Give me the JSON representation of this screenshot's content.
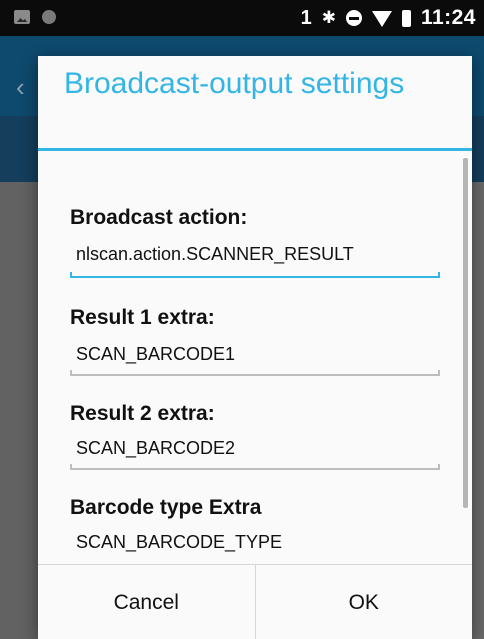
{
  "status_bar": {
    "sim_label": "1",
    "time": "11:24",
    "icons": [
      "image-icon",
      "notification-dot-icon",
      "bluetooth-icon",
      "do-not-disturb-icon",
      "wifi-icon",
      "battery-icon"
    ]
  },
  "dialog": {
    "title": "Broadcast-output settings",
    "fields": [
      {
        "label": "Broadcast action:",
        "value": "nlscan.action.SCANNER_RESULT",
        "focused": true
      },
      {
        "label": "Result 1 extra:",
        "value": "SCAN_BARCODE1",
        "focused": false
      },
      {
        "label": "Result 2 extra:",
        "value": "SCAN_BARCODE2",
        "focused": false
      },
      {
        "label": "Barcode type Extra",
        "value": "SCAN_BARCODE_TYPE",
        "focused": false
      }
    ],
    "buttons": {
      "cancel": "Cancel",
      "ok": "OK"
    }
  },
  "colors": {
    "accent": "#33b5e5",
    "status_bar": "#0b0b0b",
    "app_bar": "#0e4a6e",
    "scrim": "#626262"
  }
}
